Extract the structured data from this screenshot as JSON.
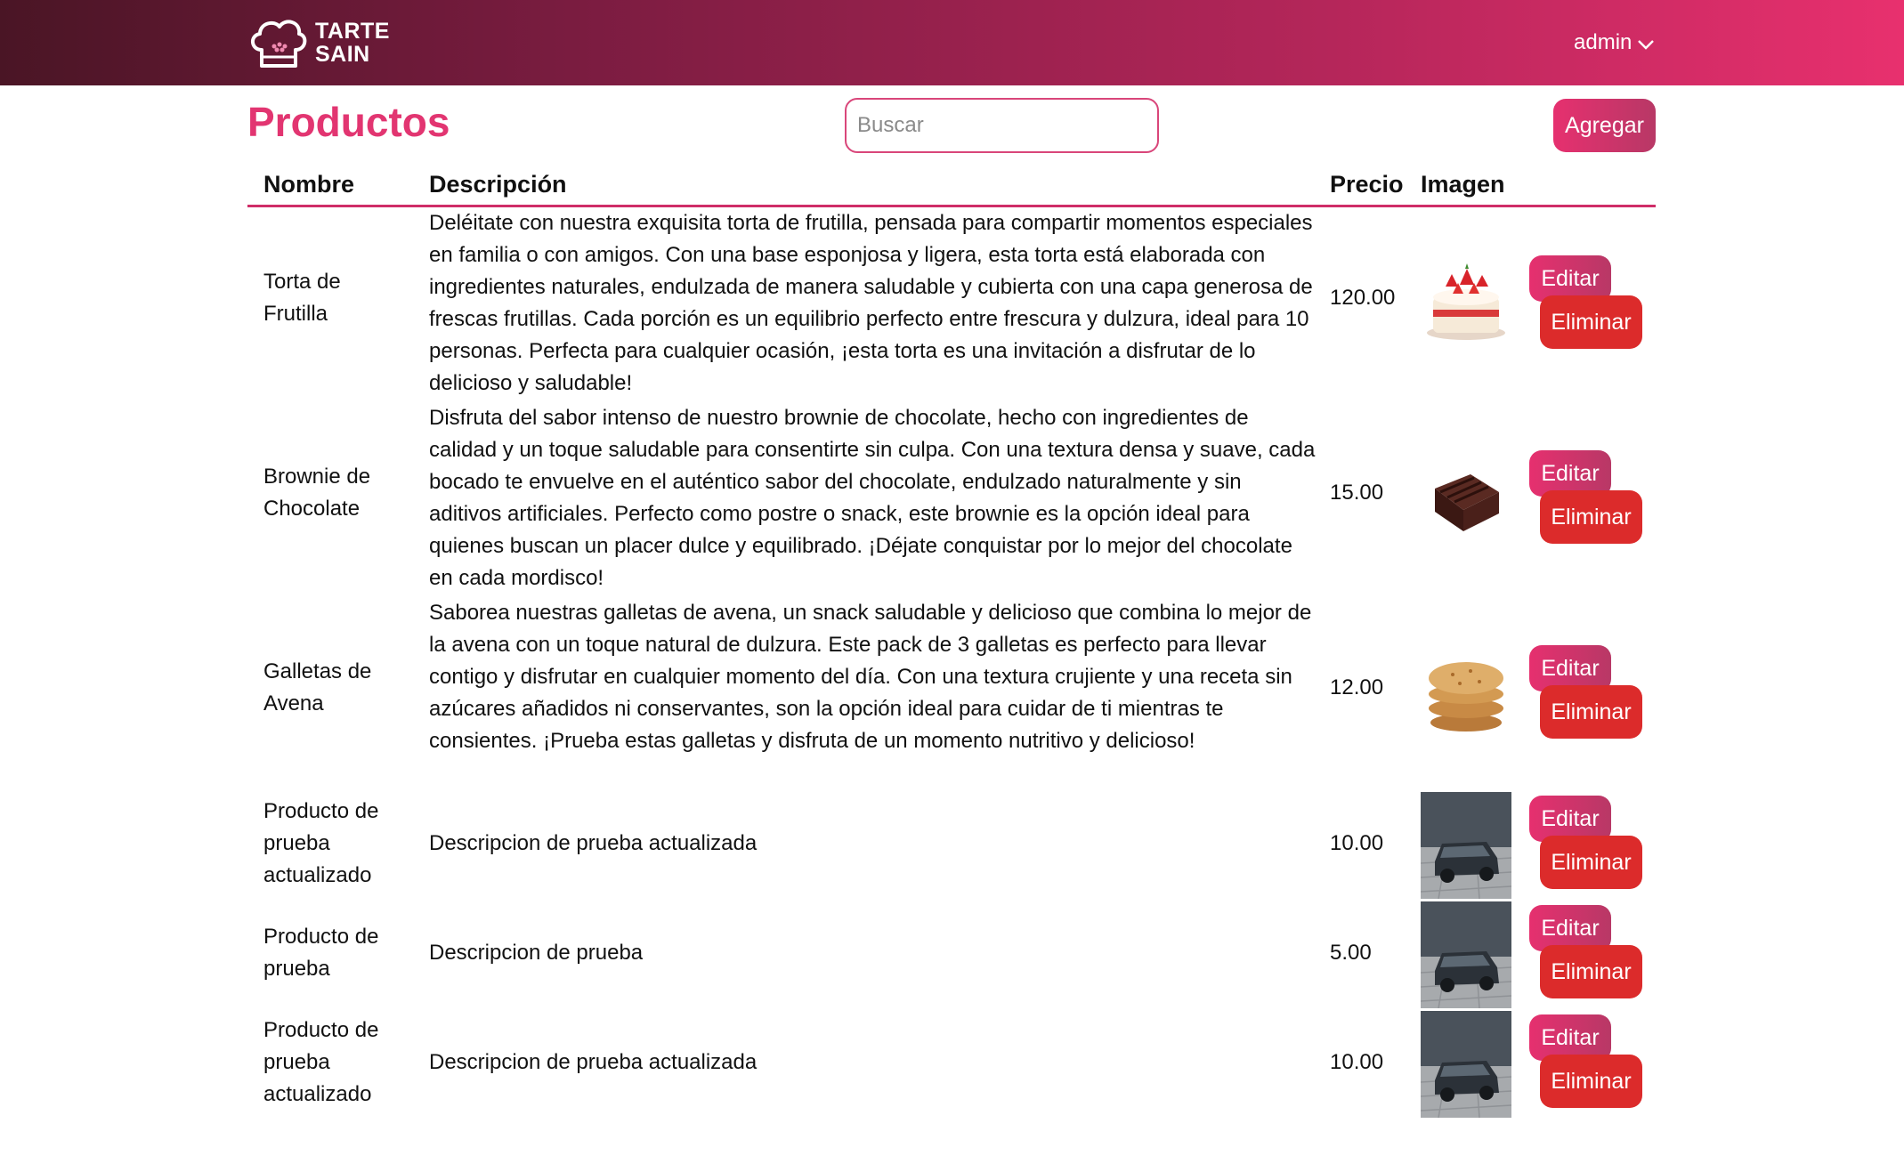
{
  "brand": {
    "line1": "TARTE",
    "line2": "SAIN",
    "icon": "chef-hat-icon"
  },
  "user_menu": {
    "label": "admin",
    "icon": "chevron-down-icon"
  },
  "page": {
    "title": "Productos",
    "search_placeholder": "Buscar",
    "add_label": "Agregar"
  },
  "table": {
    "headers": {
      "nombre": "Nombre",
      "descripcion": "Descripción",
      "precio": "Precio",
      "imagen": "Imagen"
    },
    "edit_label": "Editar",
    "delete_label": "Eliminar",
    "rows": [
      {
        "name": "Torta de Frutilla",
        "description": "Deléitate con nuestra exquisita torta de frutilla, pensada para compartir momentos especiales en familia o con amigos. Con una base esponjosa y ligera, esta torta está elaborada con ingredientes naturales, endulzada de manera saludable y cubierta con una capa generosa de frescas frutillas. Cada porción es un equilibrio perfecto entre frescura y dulzura, ideal para 10 personas. Perfecta para cualquier ocasión, ¡esta torta es una invitación a disfrutar de lo delicioso y saludable!",
        "price": "120.00",
        "image": "strawberry-cake-image"
      },
      {
        "name": "Brownie de Chocolate",
        "description": "Disfruta del sabor intenso de nuestro brownie de chocolate, hecho con ingredientes de calidad y un toque saludable para consentirte sin culpa. Con una textura densa y suave, cada bocado te envuelve en el auténtico sabor del chocolate, endulzado naturalmente y sin aditivos artificiales. Perfecto como postre o snack, este brownie es la opción ideal para quienes buscan un placer dulce y equilibrado. ¡Déjate conquistar por lo mejor del chocolate en cada mordisco!",
        "price": "15.00",
        "image": "brownie-image"
      },
      {
        "name": "Galletas de Avena",
        "description": "Saborea nuestras galletas de avena, un snack saludable y delicioso que combina lo mejor de la avena con un toque natural de dulzura. Este pack de 3 galletas es perfecto para llevar contigo y disfrutar en cualquier momento del día. Con una textura crujiente y una receta sin azúcares añadidos ni conservantes, son la opción ideal para cuidar de ti mientras te consientes. ¡Prueba estas galletas y disfruta de un momento nutritivo y delicioso!",
        "price": "12.00",
        "image": "oat-cookies-image"
      },
      {
        "name": "Producto de prueba actualizado",
        "description": "Descripcion de prueba actualizada",
        "price": "10.00",
        "image": "car-photo-image"
      },
      {
        "name": "Producto de prueba",
        "description": "Descripcion de prueba",
        "price": "5.00",
        "image": "car-photo-image"
      },
      {
        "name": "Producto de prueba actualizado",
        "description": "Descripcion de prueba actualizada",
        "price": "10.00",
        "image": "car-photo-image"
      }
    ]
  },
  "colors": {
    "accent": "#e23571",
    "danger": "#dc2b2b",
    "header_start": "#4a1525",
    "header_end": "#e8306e"
  }
}
